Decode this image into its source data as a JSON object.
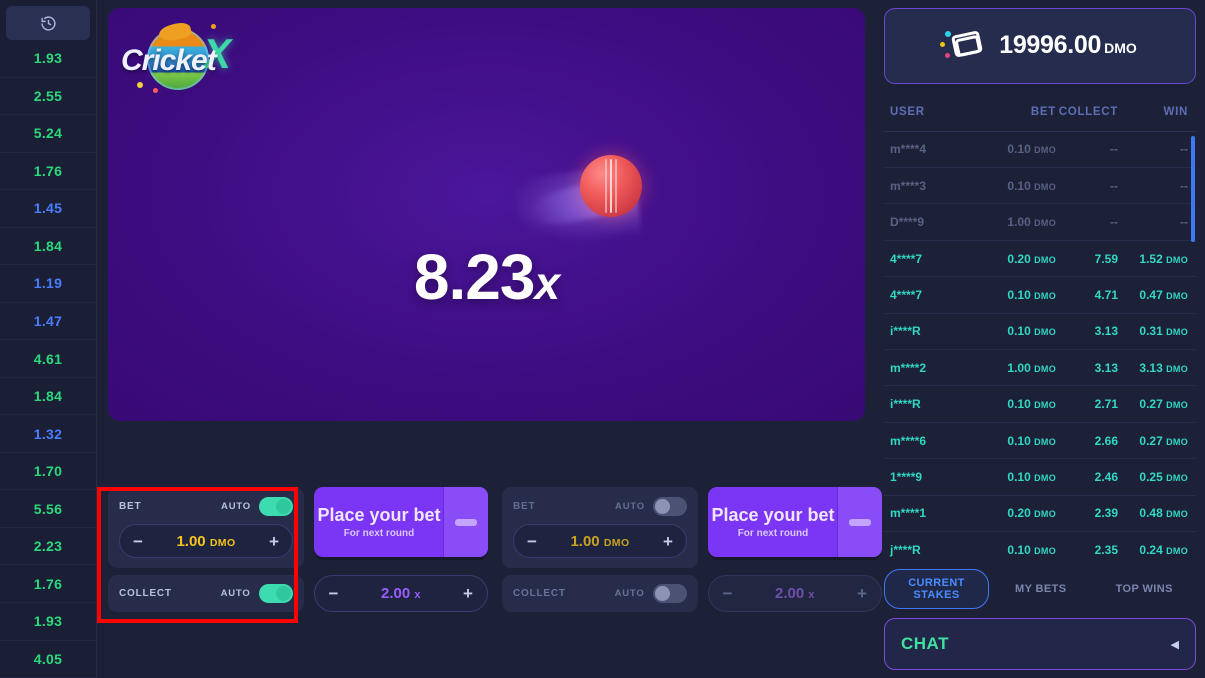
{
  "history": {
    "icon": "history-clock-icon",
    "items": [
      {
        "value": "1.93",
        "color": "green"
      },
      {
        "value": "2.55",
        "color": "green"
      },
      {
        "value": "5.24",
        "color": "green"
      },
      {
        "value": "1.76",
        "color": "green"
      },
      {
        "value": "1.45",
        "color": "blue"
      },
      {
        "value": "1.84",
        "color": "green"
      },
      {
        "value": "1.19",
        "color": "blue"
      },
      {
        "value": "1.47",
        "color": "blue"
      },
      {
        "value": "4.61",
        "color": "green"
      },
      {
        "value": "1.84",
        "color": "green"
      },
      {
        "value": "1.32",
        "color": "blue"
      },
      {
        "value": "1.70",
        "color": "green"
      },
      {
        "value": "5.56",
        "color": "green"
      },
      {
        "value": "2.23",
        "color": "green"
      },
      {
        "value": "1.76",
        "color": "green"
      },
      {
        "value": "1.93",
        "color": "green"
      },
      {
        "value": "4.05",
        "color": "green"
      }
    ],
    "colors": {
      "green": "#2bd97c",
      "blue": "#4a7dff"
    }
  },
  "game": {
    "logo_text": "Cricket",
    "logo_x": "X",
    "multiplier": "8.23",
    "multiplier_suffix": "x",
    "stage_color": "#43108c",
    "ball": "cricket-ball-icon"
  },
  "bet_panels": [
    {
      "bet_label": "BET",
      "auto_label": "AUTO",
      "bet_auto_on": true,
      "bet_amount": "1.00",
      "currency": "DMO",
      "minus": "−",
      "plus": "+",
      "collect_label": "COLLECT",
      "collect_auto_on": true,
      "button_title": "Place your bet",
      "button_subtitle": "For next round",
      "multiplier_value": "2.00",
      "multiplier_suffix": "x",
      "highlighted": true
    },
    {
      "bet_label": "BET",
      "auto_label": "AUTO",
      "bet_auto_on": false,
      "bet_amount": "1.00",
      "currency": "DMO",
      "minus": "−",
      "plus": "+",
      "collect_label": "COLLECT",
      "collect_auto_on": false,
      "button_title": "Place your bet",
      "button_subtitle": "For next round",
      "multiplier_value": "2.00",
      "multiplier_suffix": "x",
      "highlighted": false
    }
  ],
  "balance": {
    "icon": "wallet-icon",
    "amount": "19996.00",
    "currency": "DMO"
  },
  "bets_table": {
    "columns": {
      "user": "USER",
      "bet": "BET",
      "collect": "COLLECT",
      "win": "WIN"
    },
    "currency": "DMO",
    "rows": [
      {
        "user": "m****4",
        "bet": "0.10",
        "collect": "--",
        "win": "--",
        "state": "pending"
      },
      {
        "user": "m****3",
        "bet": "0.10",
        "collect": "--",
        "win": "--",
        "state": "pending"
      },
      {
        "user": "D****9",
        "bet": "1.00",
        "collect": "--",
        "win": "--",
        "state": "pending"
      },
      {
        "user": "4****7",
        "bet": "0.20",
        "collect": "7.59",
        "win": "1.52",
        "state": "won"
      },
      {
        "user": "4****7",
        "bet": "0.10",
        "collect": "4.71",
        "win": "0.47",
        "state": "won"
      },
      {
        "user": "i****R",
        "bet": "0.10",
        "collect": "3.13",
        "win": "0.31",
        "state": "won"
      },
      {
        "user": "m****2",
        "bet": "1.00",
        "collect": "3.13",
        "win": "3.13",
        "state": "won"
      },
      {
        "user": "i****R",
        "bet": "0.10",
        "collect": "2.71",
        "win": "0.27",
        "state": "won"
      },
      {
        "user": "m****6",
        "bet": "0.10",
        "collect": "2.66",
        "win": "0.27",
        "state": "won"
      },
      {
        "user": "1****9",
        "bet": "0.10",
        "collect": "2.46",
        "win": "0.25",
        "state": "won"
      },
      {
        "user": "m****1",
        "bet": "0.20",
        "collect": "2.39",
        "win": "0.48",
        "state": "won"
      },
      {
        "user": "j****R",
        "bet": "0.10",
        "collect": "2.35",
        "win": "0.24",
        "state": "won"
      }
    ]
  },
  "tabs": [
    {
      "label": "CURRENT STAKES",
      "active": true
    },
    {
      "label": "MY BETS",
      "active": false
    },
    {
      "label": "TOP WINS",
      "active": false
    }
  ],
  "chat": {
    "label": "CHAT",
    "arrow": "◀"
  }
}
